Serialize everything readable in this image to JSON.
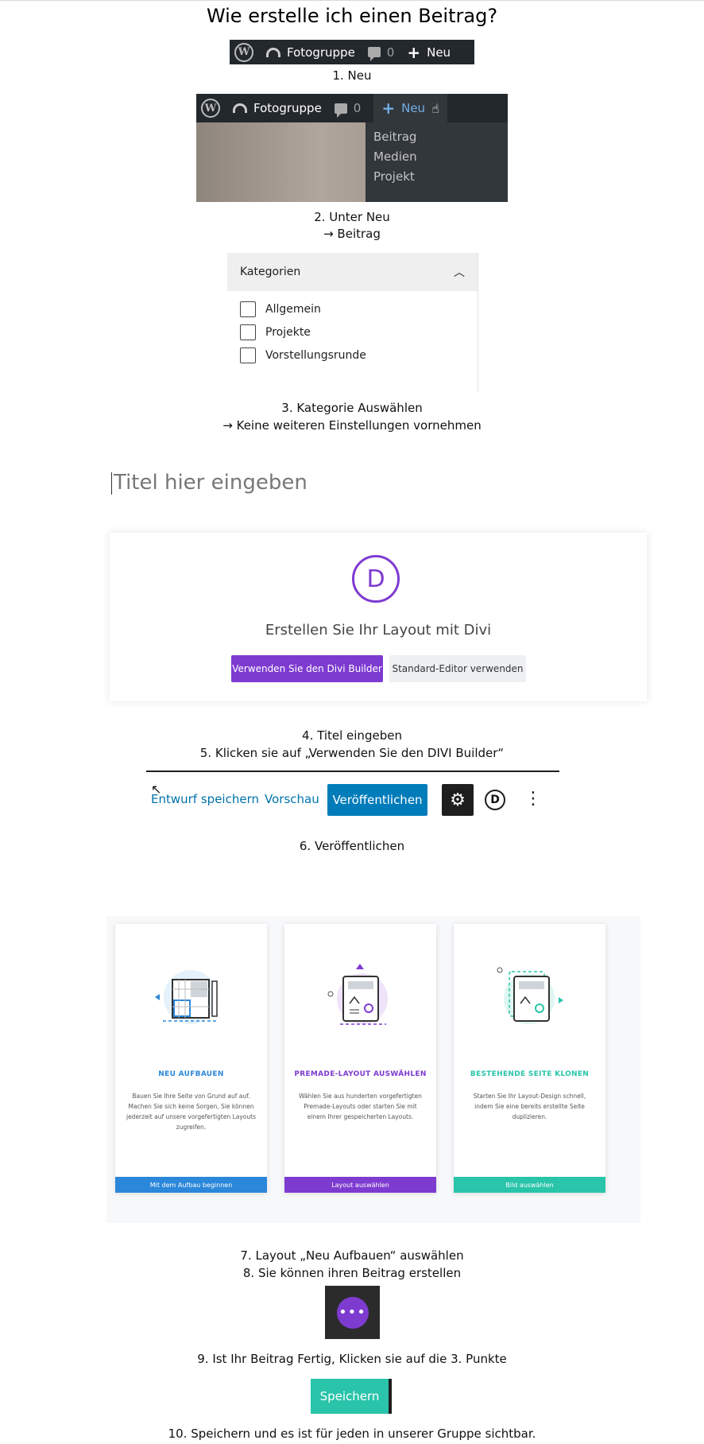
{
  "page_title": "Wie erstelle ich einen Beitrag?",
  "wpbar": {
    "site_name": "Fotogruppe",
    "comment_count": "0",
    "new_label": "Neu"
  },
  "dropdown": {
    "items": [
      "Beitrag",
      "Medien",
      "Projekt"
    ]
  },
  "steps": {
    "s1": "1. Neu",
    "s2a": "2.  Unter Neu",
    "s2b": "→ Beitrag",
    "s3a": "3. Kategorie Auswählen",
    "s3b": "→ Keine weiteren Einstellungen vornehmen",
    "s4": "4. Titel eingeben",
    "s5": "5. Klicken sie auf „Verwenden Sie den DIVI Builder“",
    "s6": "6. Veröffentlichen",
    "s7": "7. Layout „Neu Aufbauen“ auswählen",
    "s8": "8. Sie können ihren Beitrag erstellen",
    "s9": "9. Ist Ihr Beitrag Fertig, Klicken sie auf die 3. Punkte",
    "s10": "10. Speichern und es ist für jeden in unserer Gruppe sichtbar."
  },
  "categories": {
    "heading": "Kategorien",
    "items": [
      "Allgemein",
      "Projekte",
      "Vorstellungsrunde"
    ]
  },
  "editor": {
    "title_placeholder": "Titel hier eingeben"
  },
  "divi": {
    "logo_letter": "D",
    "heading": "Erstellen Sie Ihr Layout mit Divi",
    "use_builder": "Verwenden Sie den Divi Builder",
    "standard_editor": "Standard-Editor verwenden"
  },
  "publish_toolbar": {
    "save_draft": "Entwurf speichern",
    "preview": "Vorschau",
    "publish": "Veröffentlichen",
    "divi_letter": "D"
  },
  "layout_cards": [
    {
      "title": "NEU AUFBAUEN",
      "description": "Bauen Sie Ihre Seite von Grund auf auf. Machen Sie sich keine Sorgen, Sie können jederzeit auf unsere vorgefertigten Layouts zugreifen.",
      "button": "Mit dem Aufbau beginnen",
      "color": "#2b87da"
    },
    {
      "title": "PREMADE-LAYOUT AUSWÄHLEN",
      "description": "Wählen Sie aus hunderten vorgefertigten Premade-Layouts oder starten Sie mit einem Ihrer gespeicherten Layouts.",
      "button": "Layout auswählen",
      "color": "#7e3bd0"
    },
    {
      "title": "BESTEHENDE SEITE KLONEN",
      "description": "Starten Sie Ihr Layout-Design schnell, indem Sie eine bereits erstellte Seite duplizieren.",
      "button": "Bild auswählen",
      "color": "#29c4a9"
    }
  ],
  "save_button": "Speichern",
  "colors": {
    "divi_purple": "#7e3bd0",
    "wp_blue": "#007cba",
    "divi_teal": "#29c4a9",
    "divi_blue": "#2b87da",
    "wp_dark": "#23282d"
  }
}
